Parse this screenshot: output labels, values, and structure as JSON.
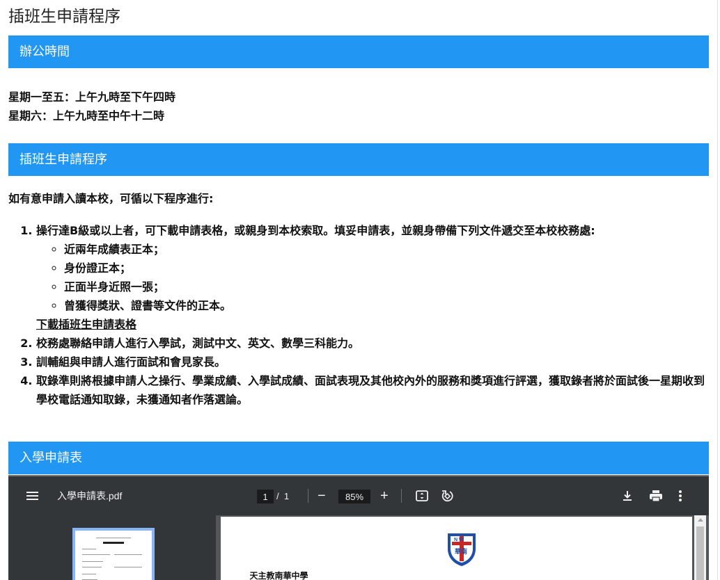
{
  "page_title": "插班生申請程序",
  "sections": {
    "office_hours": "辦公時間",
    "procedure": "插班生申請程序",
    "form": "入學申請表"
  },
  "hours": {
    "weekday": "星期一至五：上午九時至下午四時",
    "saturday": "星期六：上午九時至中午十二時"
  },
  "intro": "如有意申請入讀本校，可循以下程序進行:",
  "steps": [
    {
      "text": "操行達B級或以上者，可下載申請表格，或親身到本校索取。填妥申請表，並親身帶備下列文件遞交至本校校務處:",
      "subitems": [
        "近兩年成績表正本；",
        "身份證正本；",
        "正面半身近照一張；",
        "曾獲得獎狀、證書等文件的正本。"
      ],
      "link": "下載插班生申請表格"
    },
    {
      "text": "校務處聯絡申請人進行入學試，測試中文、英文、數學三科能力。"
    },
    {
      "text": "訓輔組與申請人進行面試和會見家長。"
    },
    {
      "text": "取錄準則將根據申請人之操行、學業成績、入學試成績、面試表現及其他校內外的服務和獎項進行評選，獲取錄者將於面試後一星期收到學校電話通知取錄，未獲通知者作落選論。"
    }
  ],
  "pdf_viewer": {
    "filename": "入學申請表.pdf",
    "current_page": "1",
    "page_separator": "/",
    "total_pages": "1",
    "zoom": "85%",
    "zoom_out": "−",
    "zoom_in": "+",
    "document_heading": "天主教南華中學",
    "logo_text": "華南",
    "logo_letters": "N W"
  },
  "colors": {
    "section_bar": "#2196f3",
    "toolbar": "#323639",
    "thumb_border": "#8ab4f8"
  },
  "icons": [
    "menu-icon",
    "fit-page-icon",
    "rotate-icon",
    "download-icon",
    "print-icon",
    "more-vert-icon"
  ]
}
